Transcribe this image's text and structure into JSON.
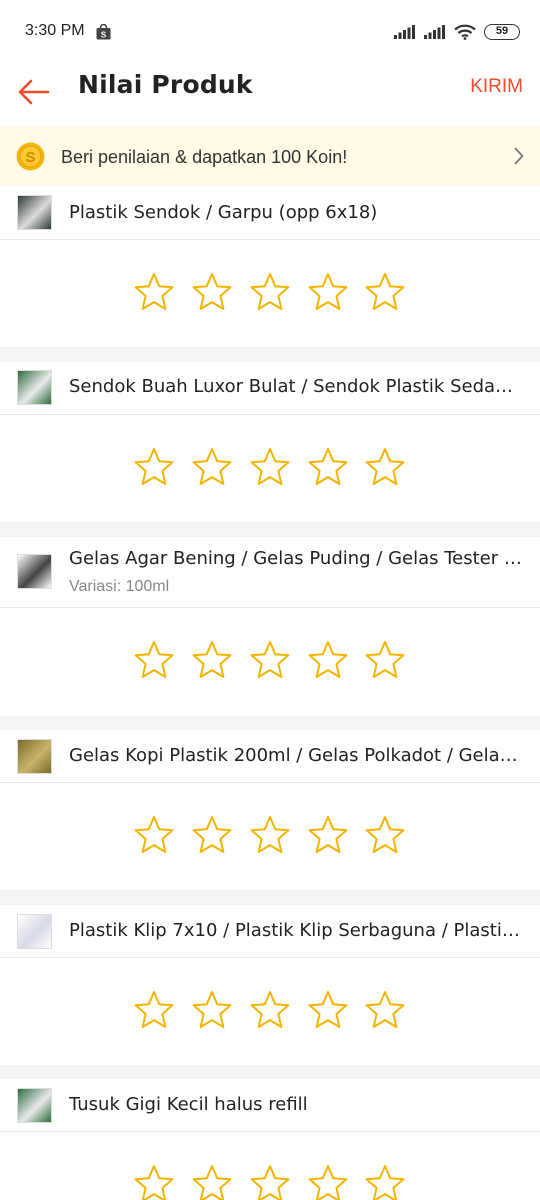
{
  "status_bar": {
    "time": "3:30 PM",
    "battery": "59",
    "icons": [
      "shopping-bag-icon",
      "signal-icon",
      "signal-icon",
      "wifi-icon",
      "battery-icon"
    ]
  },
  "app_bar": {
    "title": "Nilai Produk",
    "send_label": "KIRIM",
    "back_icon": "arrow-left-icon"
  },
  "coin_banner": {
    "text": "Beri penilaian & dapatkan 100 Koin!",
    "icon": "coin-icon",
    "chevron_icon": "chevron-right-icon"
  },
  "colors": {
    "accent": "#ee4d2d",
    "star": "#f5b400",
    "banner_bg": "#fffbe6",
    "separator": "#f5f5f5"
  },
  "products": [
    {
      "name": "Plastik Sendok / Garpu (opp 6x18)",
      "variation": "",
      "rating": 0,
      "max_rating": 5
    },
    {
      "name": "Sendok Buah Luxor Bulat / Sendok Plastik Sedang ...",
      "variation": "",
      "rating": 0,
      "max_rating": 5
    },
    {
      "name": "Gelas Agar Bening / Gelas Puding / Gelas Tester / ...",
      "variation": "Variasi: 100ml",
      "rating": 0,
      "max_rating": 5
    },
    {
      "name": "Gelas Kopi Plastik 200ml / Gelas Polkadot / Gelas ...",
      "variation": "",
      "rating": 0,
      "max_rating": 5
    },
    {
      "name": "Plastik Klip 7x10 / Plastik Klip Serbaguna / Plastik ...",
      "variation": "",
      "rating": 0,
      "max_rating": 5
    },
    {
      "name": "Tusuk Gigi Kecil halus refill",
      "variation": "",
      "rating": 0,
      "max_rating": 5
    }
  ]
}
